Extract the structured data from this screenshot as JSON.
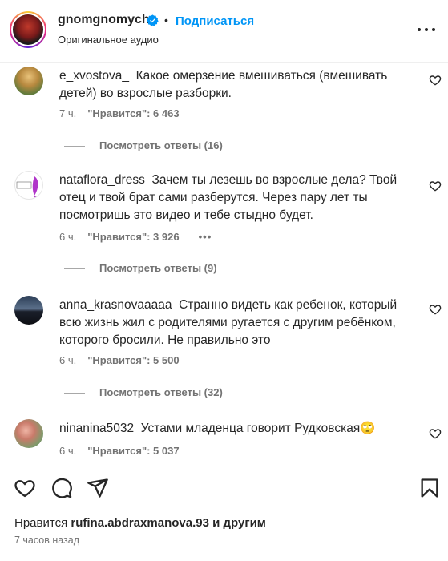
{
  "header": {
    "username": "gnomgnomych",
    "separator": "•",
    "follow_label": "Подписаться",
    "audio_label": "Оригинальное аудио",
    "verified_icon": "verified-badge-icon",
    "more_icon": "more-horizontal-icon"
  },
  "comments": [
    {
      "username": "e_xvostova_",
      "text": "Какое омерзение вмешиваться (вмешивать детей) во взрослые разборки.",
      "time": "7 ч.",
      "likes": "\"Нравится\": 6 463",
      "replies": "Посмотреть ответы (16)"
    },
    {
      "username": "nataflora_dress",
      "text": "Зачем ты лезешь во взрослые дела? Твой отец и твой брат сами разберутся. Через пару лет ты посмотришь это видео и тебе стыдно будет.",
      "time": "6 ч.",
      "likes": "\"Нравится\": 3 926",
      "more": "•••",
      "replies": "Посмотреть ответы (9)"
    },
    {
      "username": "anna_krasnovaaaaa",
      "text": "Странно видеть как ребенок, который всю жизнь жил с родителями ругается с другим ребёнком, которого бросили. Не правильно это",
      "time": "6 ч.",
      "likes": "\"Нравится\": 5 500",
      "replies": "Посмотреть ответы (32)"
    },
    {
      "username": "ninanina5032",
      "text": "Устами младенца говорит Рудковская🙄",
      "time": "6 ч.",
      "likes": "\"Нравится\": 5 037"
    }
  ],
  "footer": {
    "liked_prefix": "Нравится",
    "liked_user": "rufina.abdraxmanova.93",
    "liked_suffix": "и другим",
    "time_ago": "7 часов назад"
  },
  "icons": [
    "heart-icon",
    "comment-icon",
    "share-icon",
    "bookmark-icon"
  ],
  "colors": {
    "accent": "#0095f6",
    "text": "#262626",
    "secondary": "#737373"
  }
}
